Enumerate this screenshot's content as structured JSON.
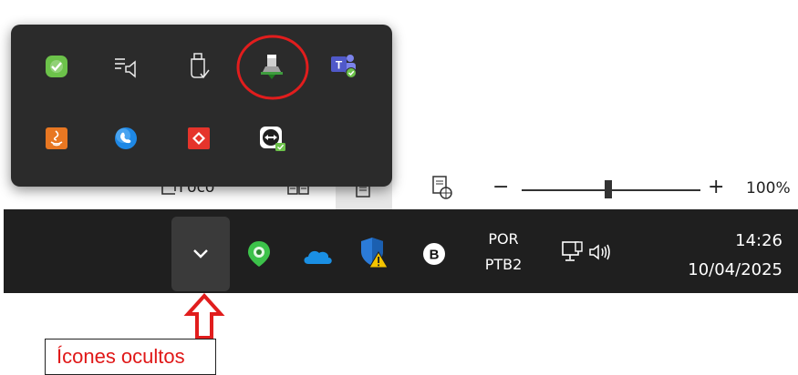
{
  "statusbar": {
    "focus_label": "Foco",
    "zoom_minus": "−",
    "zoom_plus": "+",
    "zoom_level": "100%"
  },
  "flyout": {
    "row1": [
      "security-check-icon",
      "queue-audio-icon",
      "usb-safely-remove-icon",
      "network-installer-icon",
      "teams-icon"
    ],
    "row2": [
      "java-icon",
      "skype-icon",
      "anydesk-icon",
      "teamviewer-icon"
    ]
  },
  "taskbar": {
    "language_line1": "POR",
    "language_line2": "PTB2",
    "time": "14:26",
    "date": "10/04/2025"
  },
  "annotation": {
    "label": "Ícones ocultos"
  }
}
